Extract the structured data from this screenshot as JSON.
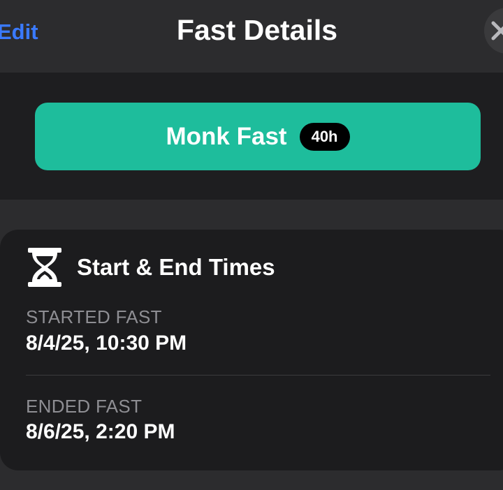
{
  "header": {
    "edit_label": "Edit",
    "title": "Fast Details"
  },
  "fast_type": {
    "name": "Monk Fast",
    "duration_badge": "40h",
    "color": "#1ebd9c"
  },
  "times_card": {
    "title": "Start & End Times",
    "icon": "hourglass-icon",
    "started_label": "STARTED FAST",
    "started_value": "8/4/25, 10:30 PM",
    "ended_label": "ENDED FAST",
    "ended_value": "8/6/25, 2:20 PM"
  }
}
